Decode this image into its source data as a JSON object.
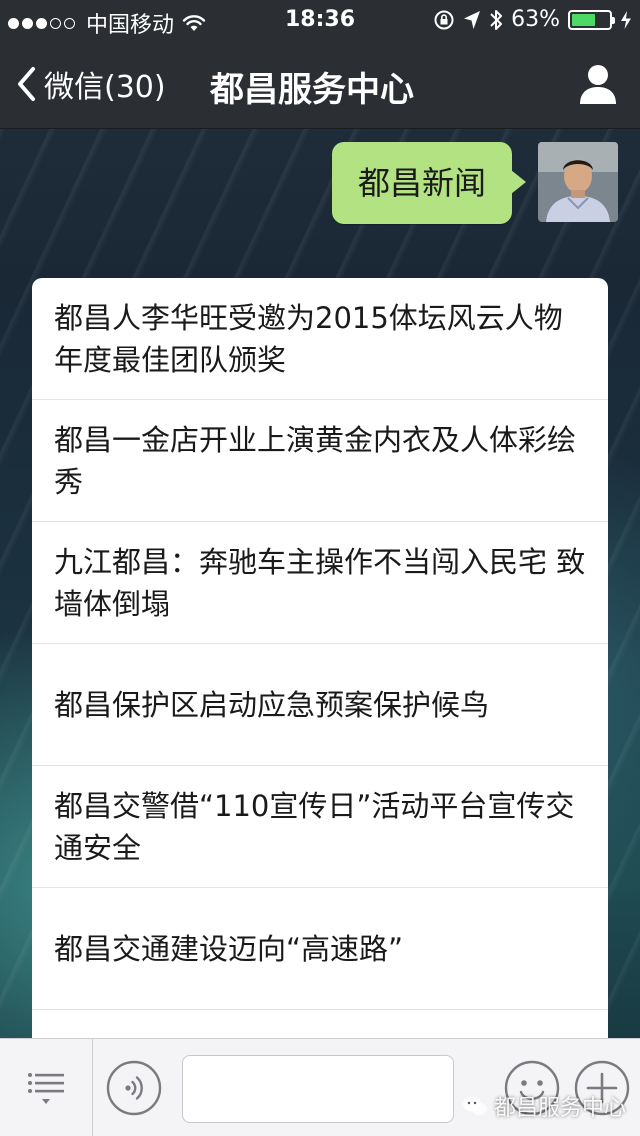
{
  "status_bar": {
    "carrier": "中国移动",
    "time": "18:36",
    "battery_text": "63%",
    "battery_level": 0.63,
    "battery_color": "#4cd964",
    "icons": [
      "signal-dots",
      "wifi-icon",
      "rotation-lock-icon",
      "location-arrow-icon",
      "bluetooth-icon",
      "battery-icon",
      "charging-bolt-icon"
    ]
  },
  "nav": {
    "back_label": "微信(30)",
    "title": "都昌服务中心",
    "right_icon": "profile-icon"
  },
  "chat": {
    "sent_message": "都昌新闻",
    "bubble_color": "#b2e281"
  },
  "news": {
    "items": [
      "都昌人李华旺受邀为2015体坛风云人物年度最佳团队颁奖",
      "都昌一金店开业上演黄金内衣及人体彩绘秀",
      "九江都昌：奔驰车主操作不当闯入民宅 致墙体倒塌",
      "都昌保护区启动应急预案保护候鸟",
      "都昌交警借“110宣传日”活动平台宣传交通安全",
      "都昌交通建设迈向“高速路”"
    ]
  },
  "toolbar": {
    "icons": [
      "menu-icon",
      "voice-icon",
      "emoji-icon",
      "plus-icon"
    ]
  },
  "watermark": {
    "text": "都昌服务中心"
  }
}
